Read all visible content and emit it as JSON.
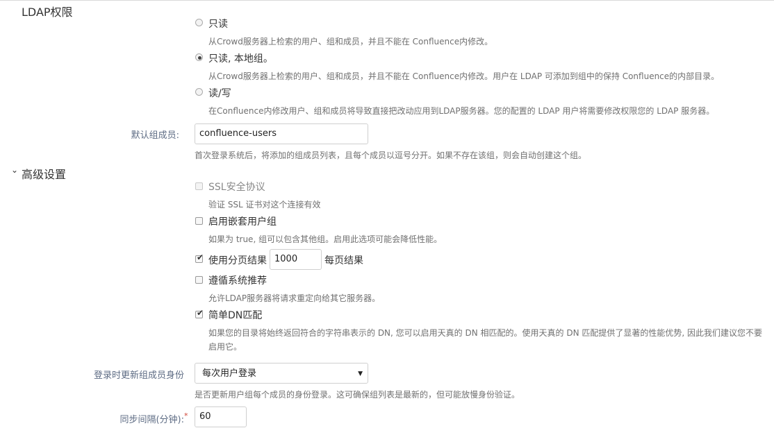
{
  "permissions": {
    "title": "LDAP权限",
    "options": [
      {
        "label": "只读",
        "desc": "从Crowd服务器上检索的用户、组和成员，并且不能在 Confluence内修改。"
      },
      {
        "label": "只读, 本地组。",
        "desc": "从Crowd服务器上检索的用户、组和成员，并且不能在 Confluence内修改。用户在 LDAP 可添加到组中的保持 Confluence的内部目录。"
      },
      {
        "label": "读/写",
        "desc": "在Confluence内修改用户、组和成员将导致直接把改动应用到LDAP服务器。您的配置的 LDAP 用户将需要修改权限您的 LDAP 服务器。"
      }
    ],
    "selected_index": 1
  },
  "default_groups": {
    "label": "默认组成员:",
    "value": "confluence-users",
    "desc": "首次登录系统后，将添加的组成员列表，且每个成员以逗号分开。如果不存在该组，则会自动创建这个组。"
  },
  "advanced": {
    "title": "高级设置",
    "ssl": {
      "label": "SSL安全协议",
      "desc": "验证 SSL 证书对这个连接有效",
      "checked": false,
      "disabled": true
    },
    "nested": {
      "label": "启用嵌套用户组",
      "desc": "如果为 true, 组可以包含其他组。启用此选项可能会降低性能。",
      "checked": false
    },
    "paged": {
      "label": "使用分页结果",
      "value": "1000",
      "suffix": "每页结果",
      "checked": true
    },
    "referrals": {
      "label": "遵循系统推荐",
      "desc": "允许LDAP服务器将请求重定向给其它服务器。",
      "checked": false
    },
    "naive_dn": {
      "label": "简单DN匹配",
      "desc_line1": "如果您的目录将始终返回符合的字符串表示的 DN, 您可以启用天真的 DN 相匹配的。使用天真的 DN 匹配提供了显著的性能优势, 因此我们建议您不要",
      "desc_line2": "启用它。",
      "checked": true
    },
    "update_membership": {
      "label": "登录时更新组成员身份",
      "selected": "每次用户登录",
      "desc": "是否更新用户组每个成员的身份登录。这可确保组列表是最新的，但可能放慢身份验证。"
    },
    "sync_interval": {
      "label": "同步间隔(分钟):",
      "required_mark": "*",
      "value": "60"
    }
  }
}
